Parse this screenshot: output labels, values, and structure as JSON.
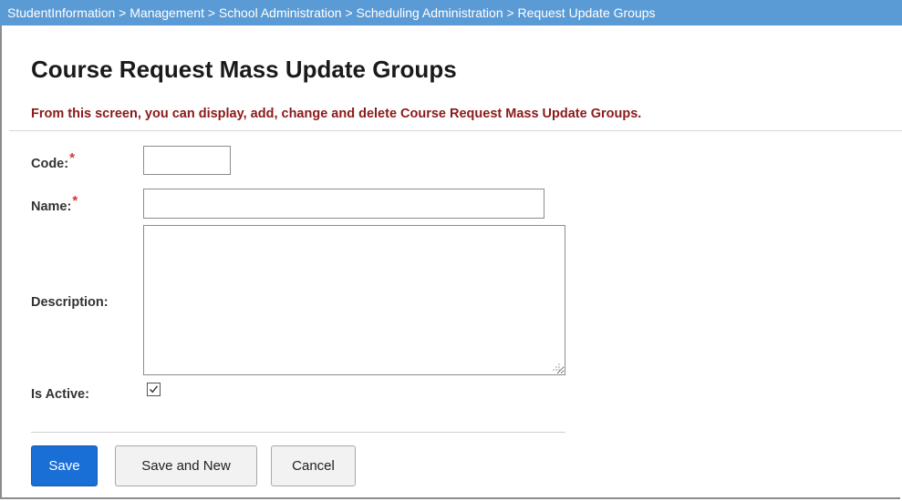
{
  "breadcrumb": {
    "text": "StudentInformation > Management > School Administration > Scheduling Administration > Request Update Groups"
  },
  "page": {
    "title": "Course Request Mass Update Groups",
    "subtitle": "From this screen, you can display, add, change and delete Course Request Mass Update Groups."
  },
  "form": {
    "required_marker": "*",
    "code": {
      "label": "Code:",
      "value": "",
      "required": true
    },
    "name": {
      "label": "Name:",
      "value": "",
      "required": true
    },
    "description": {
      "label": "Description:",
      "value": ""
    },
    "is_active": {
      "label": "Is Active:",
      "checked": true
    }
  },
  "buttons": {
    "save": "Save",
    "save_and_new": "Save and New",
    "cancel": "Cancel"
  },
  "colors": {
    "breadcrumb_bg": "#5b9bd5",
    "subtitle": "#8b1a1a",
    "required": "#d9362b",
    "primary_button": "#1a6fd6"
  },
  "icons": {
    "checkbox_checked": "check-icon",
    "textarea_resize": "resize-grip-icon"
  }
}
